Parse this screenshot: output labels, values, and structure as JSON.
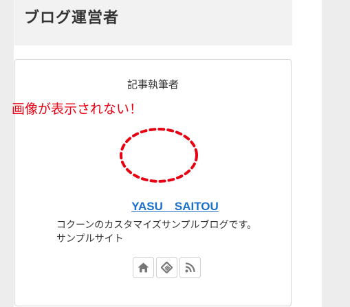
{
  "widget": {
    "title": "ブログ運営者"
  },
  "profile": {
    "heading": "記事執筆者",
    "annotation": "画像が表示されない！",
    "annotation_color": "#e60012",
    "name": "YASU　SAITOU",
    "name_color": "#1a6fc9",
    "description_line1": "コクーンのカスタマイズサンプルブログです。",
    "description_line2": "サンプルサイト"
  },
  "sns_buttons": [
    {
      "icon": "home-icon"
    },
    {
      "icon": "feedly-icon"
    },
    {
      "icon": "rss-icon"
    }
  ]
}
